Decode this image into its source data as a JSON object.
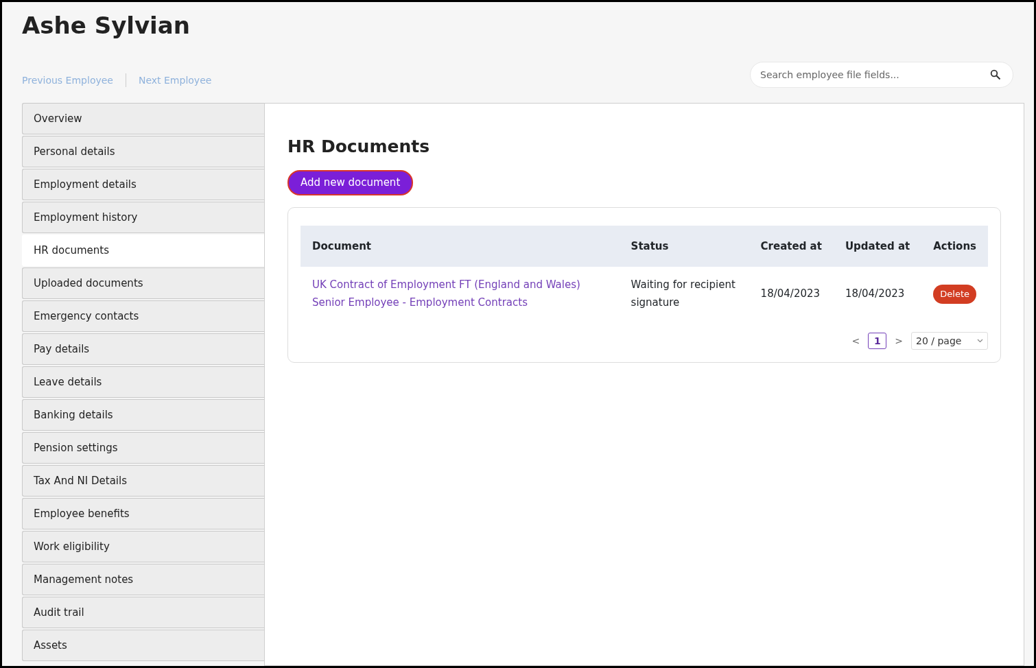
{
  "title": "Ashe Sylvian",
  "nav_links": [
    "Previous Employee",
    "Next Employee"
  ],
  "search": {
    "placeholder": "Search employee file fields..."
  },
  "sidebar": {
    "items": [
      {
        "label": "Overview",
        "selected": false
      },
      {
        "label": "Personal details",
        "selected": false
      },
      {
        "label": "Employment details",
        "selected": false
      },
      {
        "label": "Employment history",
        "selected": false
      },
      {
        "label": "HR documents",
        "selected": true
      },
      {
        "label": "Uploaded documents",
        "selected": false
      },
      {
        "label": "Emergency contacts",
        "selected": false
      },
      {
        "label": "Pay details",
        "selected": false
      },
      {
        "label": "Leave details",
        "selected": false
      },
      {
        "label": "Banking details",
        "selected": false
      },
      {
        "label": "Pension settings",
        "selected": false
      },
      {
        "label": "Tax And NI Details",
        "selected": false
      },
      {
        "label": "Employee benefits",
        "selected": false
      },
      {
        "label": "Work eligibility",
        "selected": false
      },
      {
        "label": "Management notes",
        "selected": false
      },
      {
        "label": "Audit trail",
        "selected": false
      },
      {
        "label": "Assets",
        "selected": false
      }
    ]
  },
  "content": {
    "heading": "HR Documents",
    "add_button": "Add new document",
    "table": {
      "columns": [
        "Document",
        "Status",
        "Created at",
        "Updated at",
        "Actions"
      ],
      "rows": [
        {
          "document": [
            "UK Contract of Employment FT (England and Wales)",
            "Senior Employee - Employment Contracts"
          ],
          "status": "Waiting for recipient signature",
          "created_at": "18/04/2023",
          "updated_at": "18/04/2023",
          "action": "Delete"
        }
      ]
    },
    "pagination": {
      "prev": "<",
      "pages": [
        {
          "label": "1",
          "selected": true
        }
      ],
      "next": ">",
      "page_size": "20 / page"
    }
  }
}
